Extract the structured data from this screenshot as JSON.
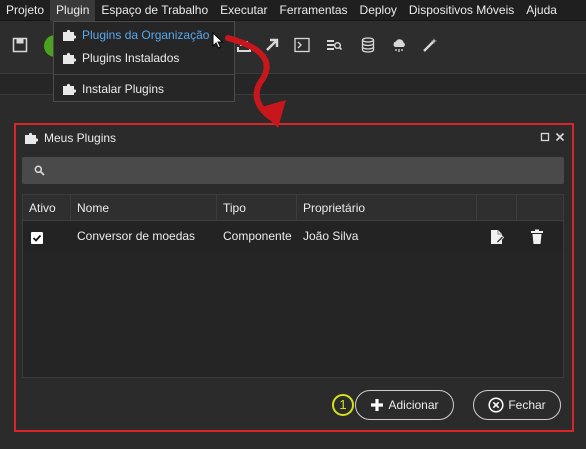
{
  "menubar": {
    "items": [
      "Projeto",
      "Plugin",
      "Espaço de Trabalho",
      "Executar",
      "Ferramentas",
      "Deploy",
      "Dispositivos Móveis",
      "Ajuda"
    ]
  },
  "plugin_menu": {
    "items": [
      "Plugins da Organização",
      "Plugins Instalados",
      "Instalar Plugins"
    ]
  },
  "dialog": {
    "title": "Meus Plugins",
    "search_placeholder": "",
    "columns": [
      "Ativo",
      "Nome",
      "Tipo",
      "Proprietário"
    ],
    "rows": [
      {
        "active": true,
        "name": "Conversor de moedas",
        "type": "Componente",
        "owner": "João Silva"
      }
    ],
    "add_label": "Adicionar",
    "close_label": "Fechar",
    "step": "1"
  },
  "colors": {
    "highlight_text": "#5aa7f0",
    "annotation_red": "#d9242a",
    "badge_yellow": "#d6e01c",
    "run_green": "#4aa21f"
  },
  "icons": [
    "save-icon",
    "export-icon",
    "publish-icon",
    "terminal-icon",
    "search-list-icon",
    "database-icon",
    "cloud-icon",
    "magic-wand-icon",
    "puzzle-icon",
    "edit-file-icon",
    "trash-icon",
    "plus-icon",
    "close-circle-icon",
    "maximize-icon",
    "close-icon"
  ]
}
